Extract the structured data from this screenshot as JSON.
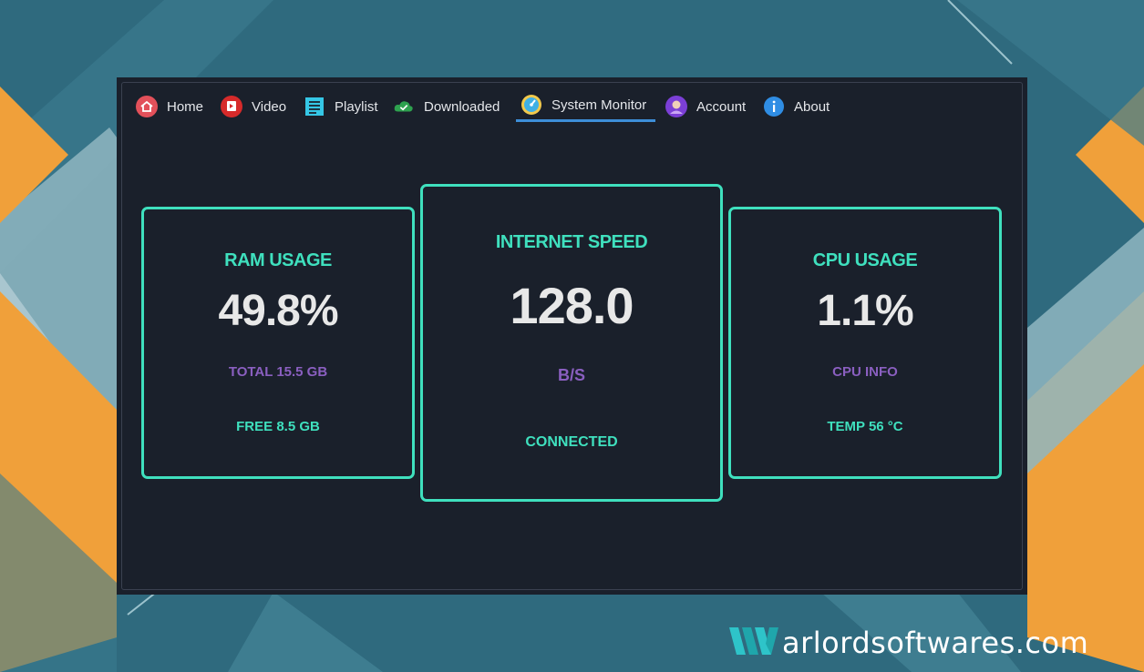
{
  "nav": {
    "tabs": [
      {
        "label": "Home",
        "icon": "home-icon"
      },
      {
        "label": "Video",
        "icon": "video-icon"
      },
      {
        "label": "Playlist",
        "icon": "playlist-icon"
      },
      {
        "label": "Downloaded",
        "icon": "cloud-check-icon"
      },
      {
        "label": "System Monitor",
        "icon": "gauge-icon",
        "active": true
      },
      {
        "label": "Account",
        "icon": "account-icon"
      },
      {
        "label": "About",
        "icon": "info-icon"
      }
    ]
  },
  "cards": {
    "ram": {
      "title": "RAM USAGE",
      "value": "49.8%",
      "sub": "TOTAL 15.5 GB",
      "foot": "FREE 8.5 GB"
    },
    "internet": {
      "title": "INTERNET SPEED",
      "value": "128.0",
      "sub": "B/S",
      "foot": "CONNECTED"
    },
    "cpu": {
      "title": "CPU USAGE",
      "value": "1.1%",
      "sub": "CPU INFO",
      "foot": "TEMP 56 °C"
    }
  },
  "watermark": {
    "text": "arlordsoftwares.com"
  },
  "colors": {
    "accent": "#3fe0be",
    "sub": "#8a5fc0",
    "active_underline": "#3d8ed8",
    "window_bg": "#1a202b"
  }
}
